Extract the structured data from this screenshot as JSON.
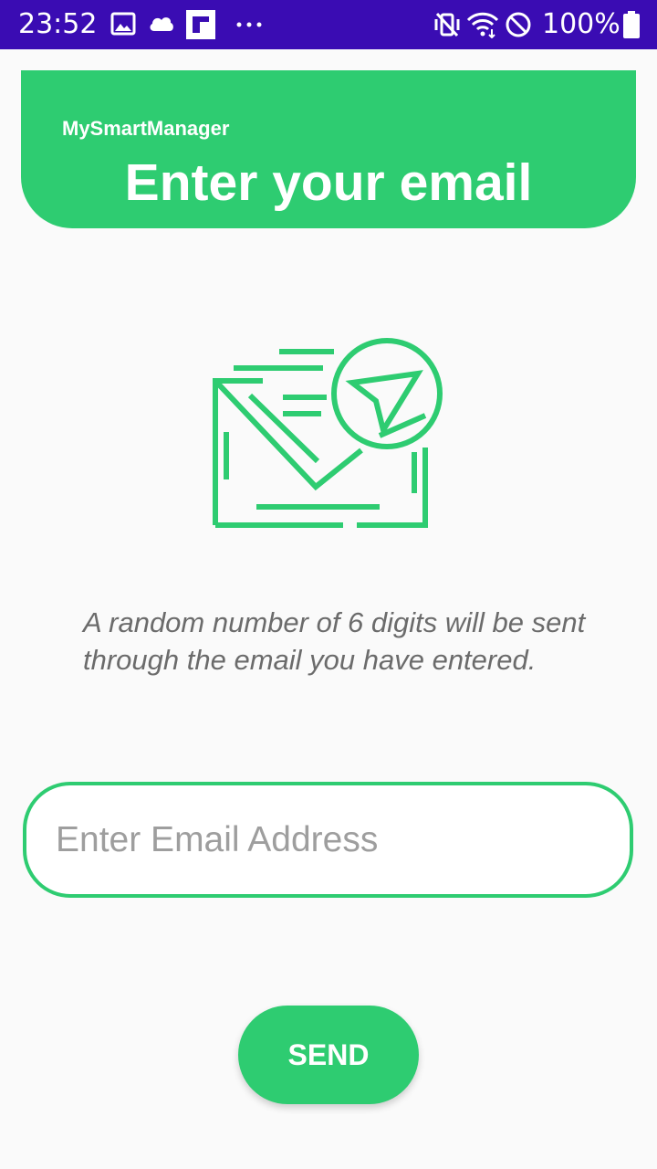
{
  "status_bar": {
    "time": "23:52",
    "battery_percent": "100%",
    "background_color": "#3a0cb3",
    "icons": [
      "image-icon",
      "cloud-icon",
      "flipboard-icon",
      "more-dots-icon",
      "vibrate-mute-icon",
      "wifi-icon",
      "do-not-disturb-icon",
      "battery-icon"
    ]
  },
  "header": {
    "app_name": "MySmartManager",
    "title": "Enter your email",
    "color": "#2ecc71"
  },
  "illustration": {
    "icon": "mail-send-icon",
    "color": "#2ecc71"
  },
  "info": {
    "text": "A random number of 6 digits will be sent through the email you have entered."
  },
  "email_input": {
    "placeholder": "Enter Email Address",
    "value": ""
  },
  "send_button": {
    "label": "SEND"
  }
}
